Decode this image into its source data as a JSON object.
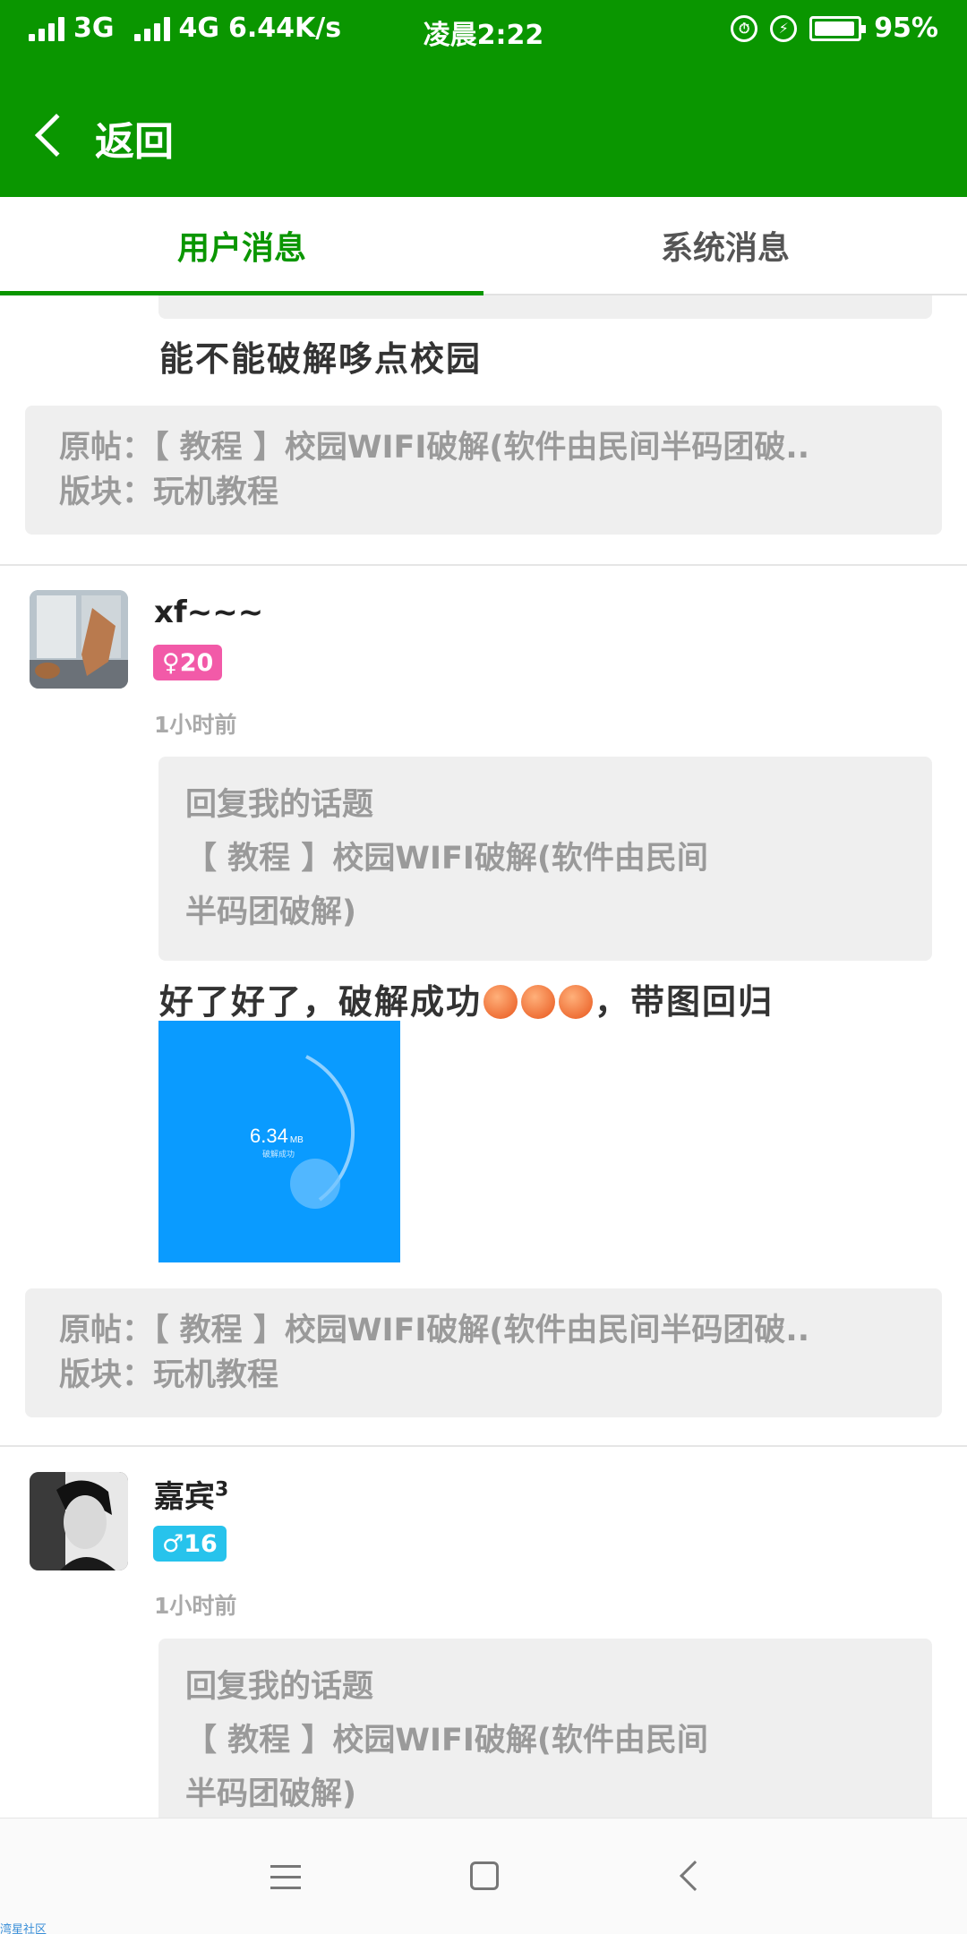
{
  "status_bar": {
    "net1": "3G",
    "net2": "4G",
    "speed": "6.44K/s",
    "time": "凌晨2:22",
    "battery": "95%",
    "alarm_icon": "alarm-clock-icon",
    "charging_icon": "bolt-icon"
  },
  "header": {
    "back_label": "返回",
    "back_icon": "chevron-left-icon"
  },
  "tabs": [
    {
      "label": "用户消息",
      "active": true
    },
    {
      "label": "系统消息",
      "active": false
    }
  ],
  "messages": [
    {
      "text": "能不能破解哆点校园",
      "origin": {
        "post": "原帖：【 教程 】校园WIFI破解(软件由民间半码团破..",
        "board": "版块：玩机教程"
      }
    },
    {
      "user": "xf~~~",
      "badge": "♀20",
      "time": "1小时前",
      "reply_lines": [
        "回复我的话题",
        "【 教程 】校园WIFI破解(软件由民间",
        "半码团破解)"
      ],
      "text_before": "好了好了，破解成功",
      "text_after": "，带图回归",
      "photo": {
        "value": "6.34",
        "unit": "MB",
        "caption": "破解成功"
      },
      "origin": {
        "post": "原帖：【 教程 】校园WIFI破解(软件由民间半码团破..",
        "board": "版块：玩机教程"
      }
    },
    {
      "user": "嘉宾",
      "user_sup": "3",
      "badge": "♂16",
      "time": "1小时前",
      "reply_lines": [
        "回复我的话题",
        "【 教程 】校园WIFI破解(软件由民间",
        "半码团破解)"
      ]
    }
  ],
  "colors": {
    "brand_green": "#0a9600",
    "female_badge": "#f25aa8",
    "male_badge": "#27c3ec",
    "photo_blue": "#0a9bff"
  },
  "watermark": "湾星社区"
}
